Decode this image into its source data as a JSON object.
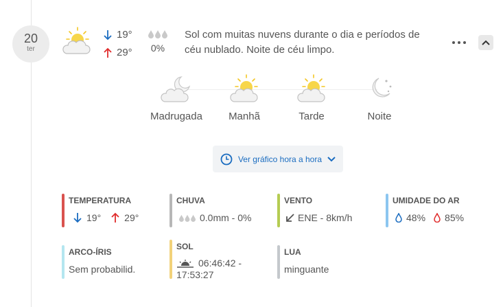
{
  "day": {
    "number": "20",
    "weekday": "ter"
  },
  "summary": {
    "temp_min": "19°",
    "temp_max": "29°",
    "rain_pct": "0%",
    "description": "Sol com muitas nuvens durante o dia e períodos de céu nublado. Noite de céu limpo."
  },
  "periods": [
    {
      "label": "Madrugada",
      "icon": "moon-cloud-icon"
    },
    {
      "label": "Manhã",
      "icon": "sun-cloud-icon"
    },
    {
      "label": "Tarde",
      "icon": "sun-cloud-icon"
    },
    {
      "label": "Noite",
      "icon": "moon-stars-icon"
    }
  ],
  "hourly_button": {
    "label": "Ver gráfico hora a hora"
  },
  "details": {
    "temperatura": {
      "title": "TEMPERATURA",
      "min": "19°",
      "max": "29°",
      "color": "#d9534f"
    },
    "chuva": {
      "title": "CHUVA",
      "value": "0.0mm - 0%",
      "color": "#b7b7b7"
    },
    "vento": {
      "title": "VENTO",
      "value": "ENE - 8km/h",
      "color": "#b5cc52"
    },
    "umidade": {
      "title": "UMIDADE DO AR",
      "min": "48%",
      "max": "85%",
      "color": "#8cc6f0"
    },
    "arco_iris": {
      "title": "ARCO-ÍRIS",
      "value": "Sem probabilid.",
      "color": "#b4e6f0"
    },
    "sol": {
      "title": "SOL",
      "value": "06:46:42 - 17:53:27",
      "color": "#f2d27a"
    },
    "lua": {
      "title": "LUA",
      "value": "minguante",
      "color": "#c4c8cc"
    }
  },
  "colors": {
    "arrow_down": "#1a6cc0",
    "arrow_up": "#e02b2b",
    "link": "#1a6cc0"
  }
}
